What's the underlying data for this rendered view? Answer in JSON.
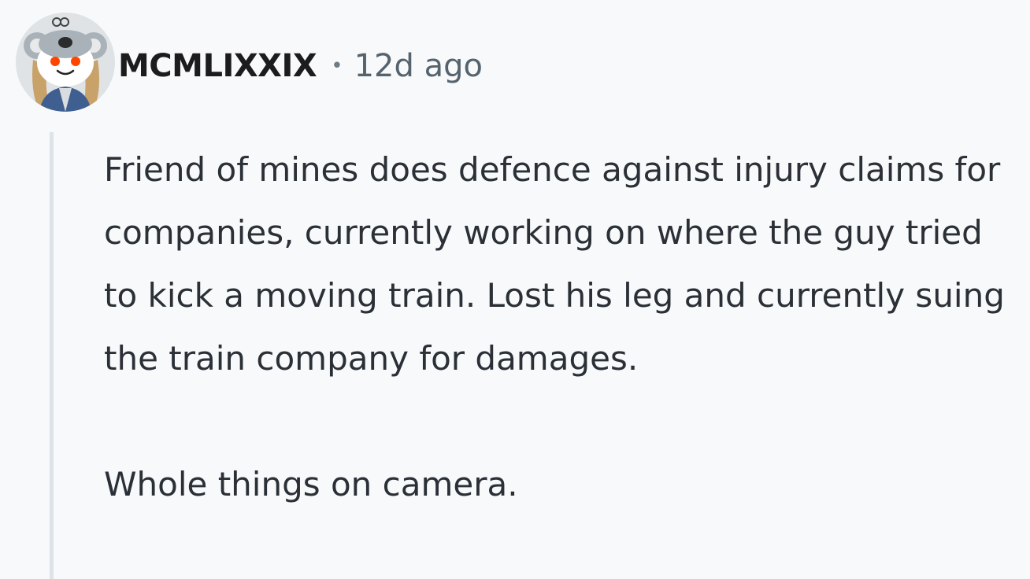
{
  "comment": {
    "avatar_icon": "koala-snoo-avatar-icon",
    "author": "MCMLIXXIX",
    "separator": "•",
    "timestamp": "12d ago",
    "paragraphs": [
      "Friend of mines does defence against injury claims for companies, currently working on where the guy tried to kick a moving train. Lost his leg and currently suing the train company for damages.",
      "Whole things on camera."
    ]
  },
  "colors": {
    "background": "#f7f9fb",
    "username": "#1c1c1c",
    "timestamp": "#56636d",
    "body_text": "#2a3036",
    "thread_line": "#dde3e8",
    "avatar_accent": "#ff4500"
  }
}
